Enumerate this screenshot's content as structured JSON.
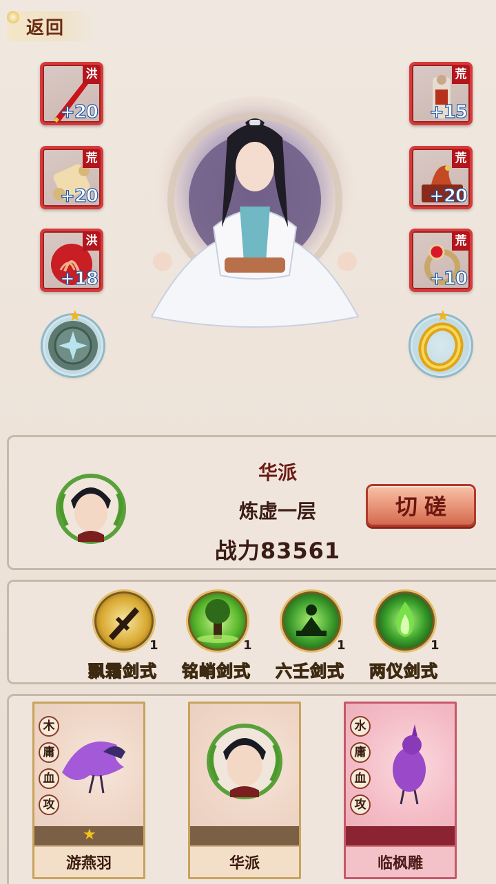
{
  "header": {
    "back_label": "返回"
  },
  "equipment": {
    "left": [
      {
        "tag": "洪",
        "level": "+20",
        "icon": "sword-icon"
      },
      {
        "tag": "荒",
        "level": "+20",
        "icon": "scroll-icon"
      },
      {
        "tag": "洪",
        "level": "+18",
        "icon": "medallion-icon"
      }
    ],
    "right": [
      {
        "tag": "荒",
        "level": "+15",
        "icon": "armor-figure-icon"
      },
      {
        "tag": "荒",
        "level": "+20",
        "icon": "dragon-chest-icon"
      },
      {
        "tag": "荒",
        "level": "+10",
        "icon": "ruby-ring-icon"
      }
    ],
    "left_round": {
      "icon": "bronze-mirror-icon",
      "stars": 1
    },
    "right_round": {
      "icon": "gold-ring-icon",
      "stars": 1
    }
  },
  "profile": {
    "faction": "华派",
    "realm": "炼虚一层",
    "power": "战力83561",
    "spar_button": "切磋"
  },
  "skills": [
    {
      "name": "飘霜剑式",
      "count": "1",
      "icon": "frost-sword-icon"
    },
    {
      "name": "铭峭剑式",
      "count": "1",
      "icon": "tree-sword-icon"
    },
    {
      "name": "六壬剑式",
      "count": "1",
      "icon": "meditate-sword-icon"
    },
    {
      "name": "两仪剑式",
      "count": "1",
      "icon": "green-flame-icon"
    }
  ],
  "partners": [
    {
      "name": "游燕羽",
      "attrs": [
        "木",
        "庸",
        "血",
        "攻"
      ],
      "stars": 1,
      "icon": "purple-phoenix-icon"
    },
    {
      "name": "华派",
      "attrs": [],
      "stars": 0,
      "icon": "portrait-icon"
    },
    {
      "name": "临枫雕",
      "attrs": [
        "水",
        "庸",
        "血",
        "攻"
      ],
      "stars": 0,
      "icon": "purple-bird-icon"
    }
  ],
  "colors": {
    "slot_border": "#d63a3a",
    "tag_bg": "#b3151c",
    "level_text": "#ffffff",
    "button_accent": "#e89276"
  }
}
